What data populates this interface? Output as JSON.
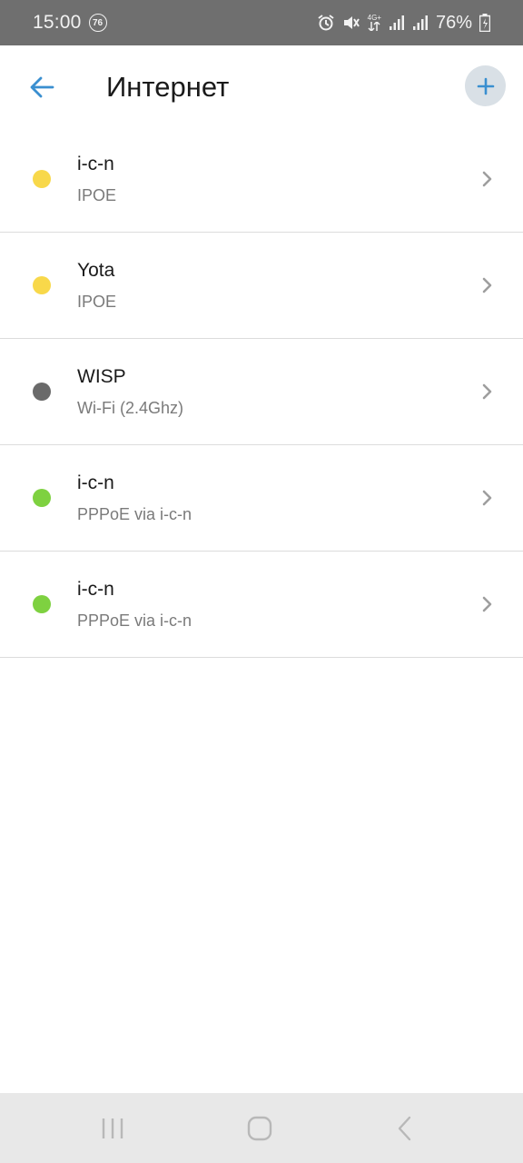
{
  "status_bar": {
    "time": "15:00",
    "badge": "76",
    "network_type": "4G+",
    "battery_percent": "76%",
    "icons": [
      "alarm-icon",
      "mute-icon",
      "signal-icon",
      "signal-icon",
      "battery-icon"
    ]
  },
  "header": {
    "title": "Интернет",
    "back_icon": "arrow-left-icon",
    "add_icon": "plus-icon",
    "accent_color": "#3a8fd0"
  },
  "connections": [
    {
      "name": "i-c-n",
      "type": "IPOE",
      "status_color": "#f8d84a"
    },
    {
      "name": "Yota",
      "type": "IPOE",
      "status_color": "#f8d84a"
    },
    {
      "name": "WISP",
      "type": "Wi-Fi (2.4Ghz)",
      "status_color": "#6a6a6a"
    },
    {
      "name": "i-c-n",
      "type": "PPPoE via i-c-n",
      "status_color": "#7ed140"
    },
    {
      "name": "i-c-n",
      "type": "PPPoE via i-c-n",
      "status_color": "#7ed140"
    }
  ],
  "nav_bar": {
    "icons": [
      "recent-apps-icon",
      "home-icon",
      "back-icon"
    ]
  }
}
